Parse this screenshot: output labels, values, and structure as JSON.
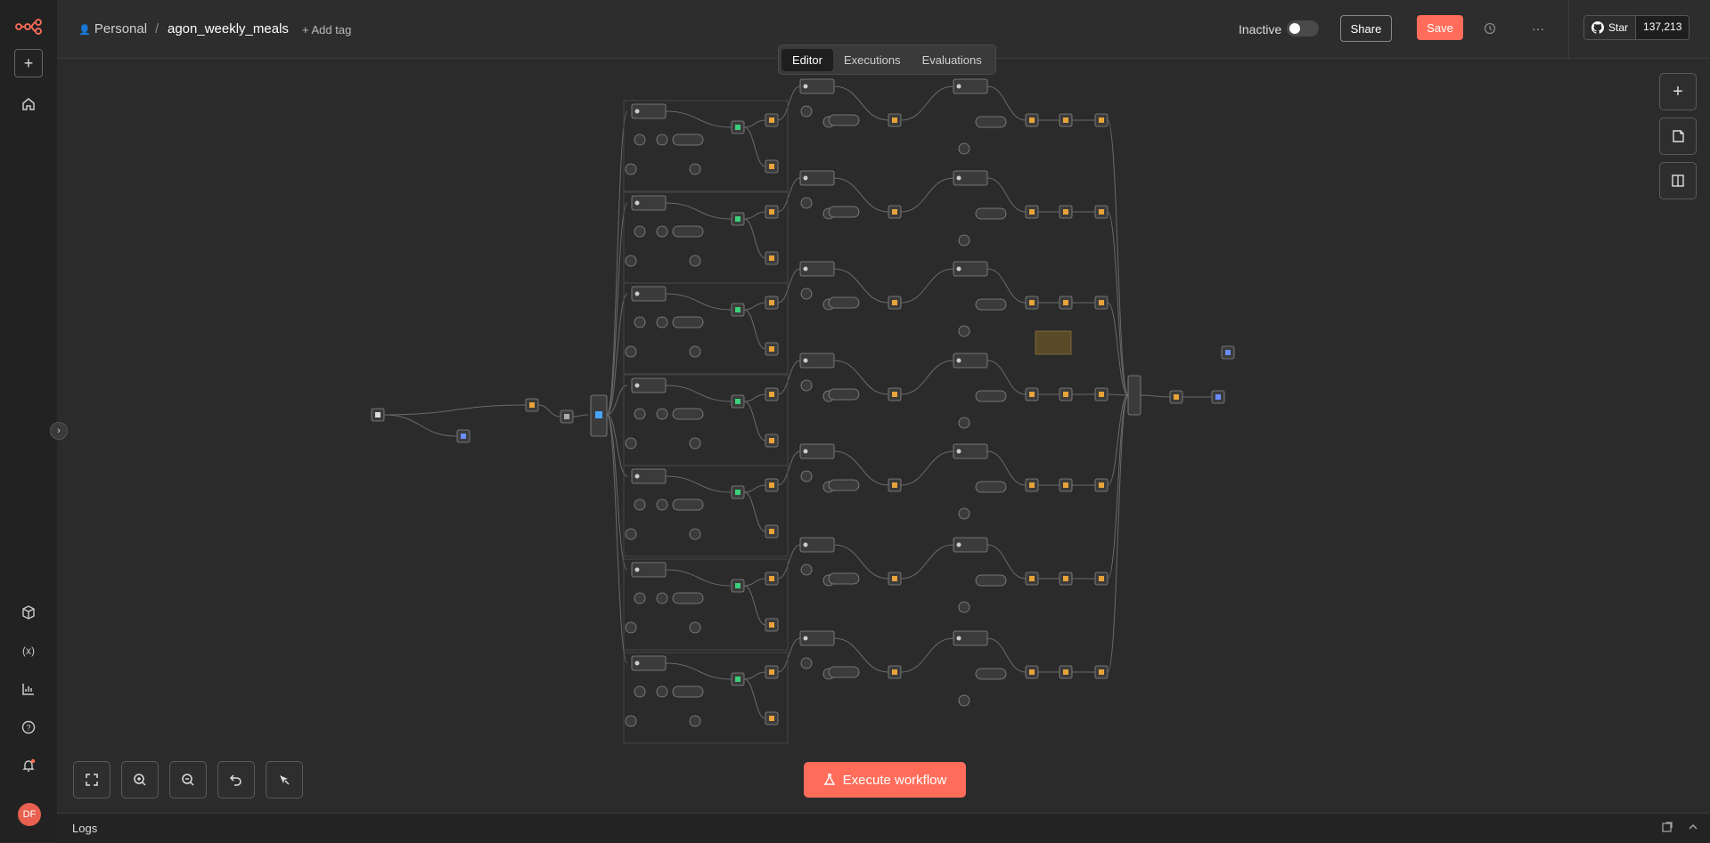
{
  "header": {
    "project": "Personal",
    "separator": "/",
    "workflow_name": "agon_weekly_meals",
    "add_tag": "+ Add tag",
    "status": "Inactive",
    "share": "Share",
    "save": "Save",
    "more": "···"
  },
  "github": {
    "star": "Star",
    "count": "137,213"
  },
  "tabs": [
    "Editor",
    "Executions",
    "Evaluations"
  ],
  "execute": "Execute workflow",
  "logs": "Logs",
  "user_initials": "DF",
  "colors": {
    "accent": "#ff6d5a",
    "canvas": "#2b2b2b",
    "sidebar": "#222222"
  },
  "icons": {
    "sidebar": [
      "n8n-logo-icon",
      "plus-icon",
      "home-icon",
      "box-icon",
      "variables-icon",
      "insights-icon",
      "help-icon",
      "bell-icon"
    ],
    "right": [
      "plus-icon",
      "sticky-note-icon",
      "panel-icon"
    ],
    "zoom": [
      "fit-view-icon",
      "zoom-in-icon",
      "zoom-out-icon",
      "undo-icon",
      "tidy-up-icon"
    ]
  }
}
